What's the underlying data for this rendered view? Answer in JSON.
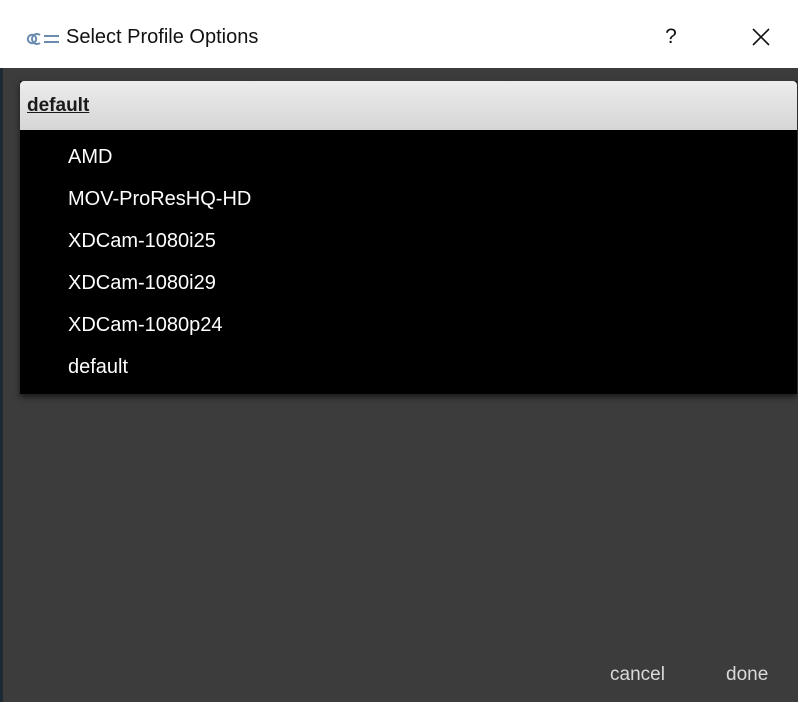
{
  "window": {
    "title": "Select Profile Options",
    "help_label": "?",
    "icons": {
      "app": "app-logo-icon",
      "close": "close-icon"
    }
  },
  "profile_select": {
    "selected": "default",
    "options": [
      "AMD",
      "MOV-ProResHQ-HD",
      "XDCam-1080i25",
      "XDCam-1080i29",
      "XDCam-1080p24",
      "default"
    ]
  },
  "footer": {
    "cancel_label": "cancel",
    "done_label": "done"
  },
  "colors": {
    "dialog_background": "#3c3c3c",
    "dropdown_background": "#000000",
    "dropdown_header": "#e0e0e0",
    "app_icon": "#6a8cb0"
  }
}
